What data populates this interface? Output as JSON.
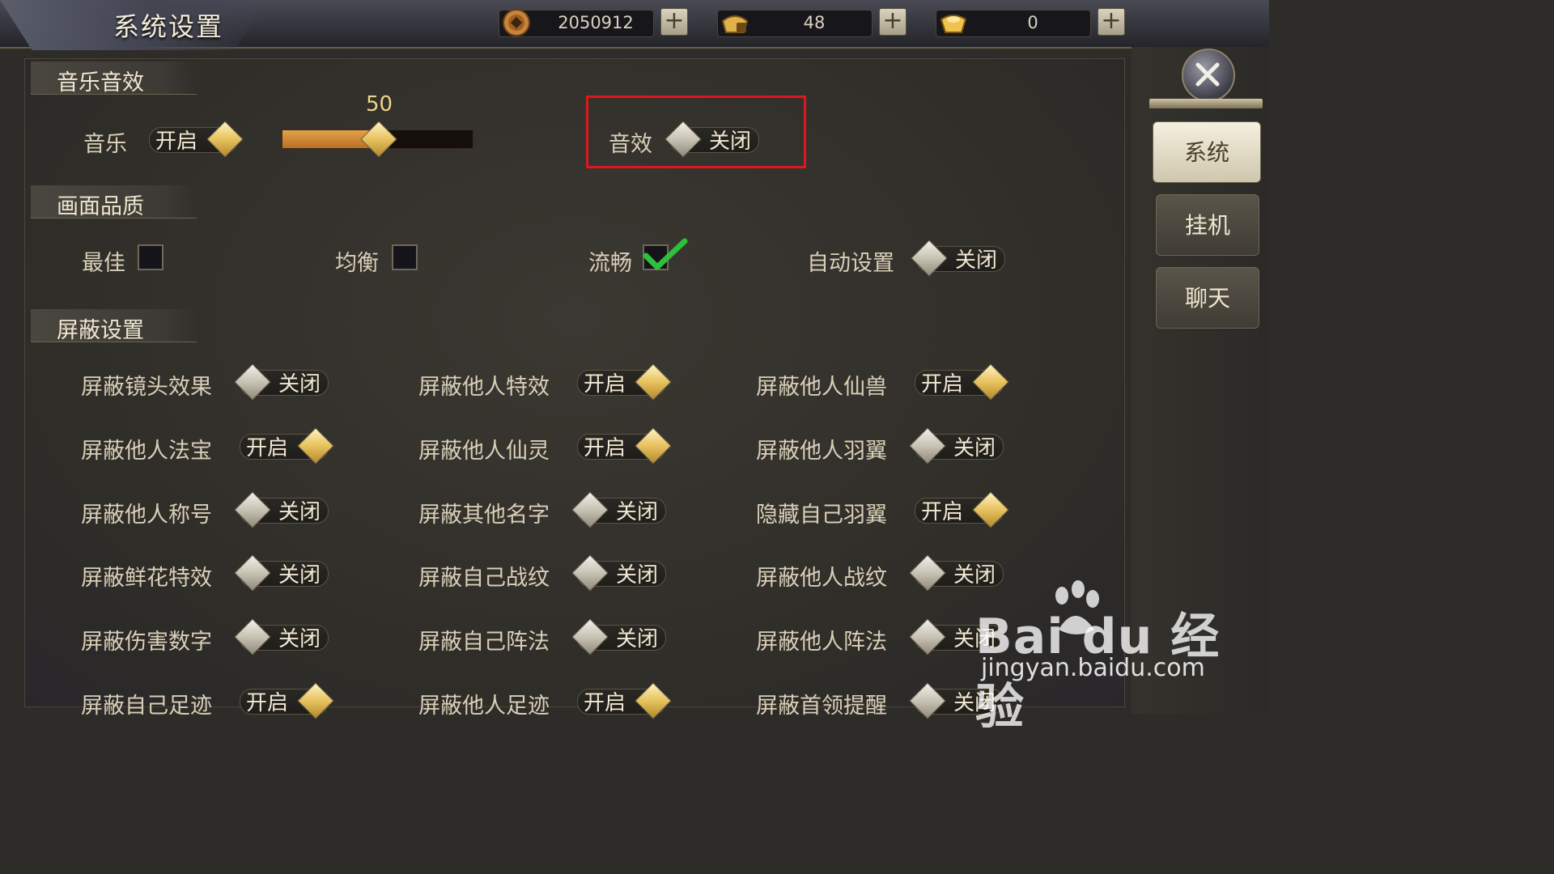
{
  "window": {
    "title": "系统设置"
  },
  "currencies": [
    {
      "icon": "copper-coin-icon",
      "value": "2050912"
    },
    {
      "icon": "locked-gold-ingot-icon",
      "value": "48"
    },
    {
      "icon": "gold-ingot-icon",
      "value": "0"
    }
  ],
  "plus_label": "+",
  "sections": {
    "audio": "音乐音效",
    "quality": "画面品质",
    "shield": "屏蔽设置"
  },
  "audio": {
    "music_label": "音乐",
    "music_toggle": "开启",
    "volume": "50",
    "volume_fraction": 0.5,
    "sfx_label": "音效",
    "sfx_toggle": "关闭"
  },
  "quality": {
    "best": "最佳",
    "balanced": "均衡",
    "smooth": "流畅",
    "selected": "流畅",
    "auto_label": "自动设置",
    "auto_toggle": "关闭"
  },
  "shield_rows": [
    [
      {
        "label": "屏蔽镜头效果",
        "state": "关闭"
      },
      {
        "label": "屏蔽他人特效",
        "state": "开启"
      },
      {
        "label": "屏蔽他人仙兽",
        "state": "开启"
      }
    ],
    [
      {
        "label": "屏蔽他人法宝",
        "state": "开启"
      },
      {
        "label": "屏蔽他人仙灵",
        "state": "开启"
      },
      {
        "label": "屏蔽他人羽翼",
        "state": "关闭"
      }
    ],
    [
      {
        "label": "屏蔽他人称号",
        "state": "关闭"
      },
      {
        "label": "屏蔽其他名字",
        "state": "关闭"
      },
      {
        "label": "隐藏自己羽翼",
        "state": "开启"
      }
    ],
    [
      {
        "label": "屏蔽鲜花特效",
        "state": "关闭"
      },
      {
        "label": "屏蔽自己战纹",
        "state": "关闭"
      },
      {
        "label": "屏蔽他人战纹",
        "state": "关闭"
      }
    ],
    [
      {
        "label": "屏蔽伤害数字",
        "state": "关闭"
      },
      {
        "label": "屏蔽自己阵法",
        "state": "关闭"
      },
      {
        "label": "屏蔽他人阵法",
        "state": "关闭"
      }
    ],
    [
      {
        "label": "屏蔽自己足迹",
        "state": "开启"
      },
      {
        "label": "屏蔽他人足迹",
        "state": "开启"
      },
      {
        "label": "屏蔽首领提醒",
        "state": "关闭"
      }
    ]
  ],
  "side_tabs": [
    "系统",
    "挂机",
    "聊天"
  ],
  "watermark": {
    "logo": "Bai du 经验",
    "url": "jingyan.baidu.com"
  },
  "colors": {
    "highlight": "#e0161b",
    "toggle_on": "#e7c25e",
    "slider_fill": "#d08a34",
    "check": "#2fbf3a"
  }
}
